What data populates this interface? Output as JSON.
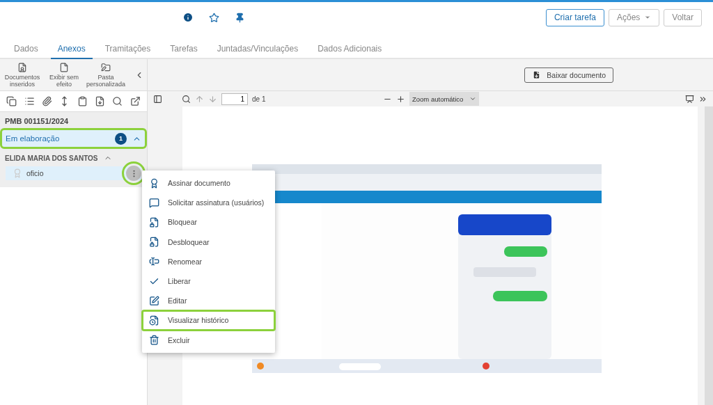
{
  "header": {
    "buttons": [
      {
        "label": "Criar tarefa",
        "kind": "primary"
      },
      {
        "label": "Ações",
        "kind": "dropdown"
      },
      {
        "label": "Voltar",
        "kind": "plain"
      }
    ]
  },
  "tabs": [
    {
      "label": "Dados",
      "selected": false
    },
    {
      "label": "Anexos",
      "selected": true
    },
    {
      "label": "Tramitações",
      "selected": false
    },
    {
      "label": "Tarefas",
      "selected": false
    },
    {
      "label": "Juntadas/Vinculações",
      "selected": false
    },
    {
      "label": "Dados Adicionais",
      "selected": false
    }
  ],
  "left_toolbar": [
    {
      "label": "Documentos inseridos"
    },
    {
      "label": "Exibir sem efeito"
    },
    {
      "label": "Pasta personalizada"
    }
  ],
  "process_number": "PMB 001151/2024",
  "group": {
    "label": "Em elaboração",
    "count": "1",
    "expanded": true,
    "highlighted": true
  },
  "author": {
    "name": "ELIDA MARIA DOS SANTOS",
    "expanded": true
  },
  "documents": [
    {
      "name": "oficio",
      "selected": true,
      "menu_highlighted": true
    }
  ],
  "viewer": {
    "download": "Baixar documento",
    "page": "1",
    "page_total": "de 1",
    "zoom": "Zoom automático"
  },
  "context_menu": [
    {
      "label": "Assinar documento",
      "highlighted": false
    },
    {
      "label": "Solicitar assinatura (usuários)",
      "highlighted": false
    },
    {
      "label": "Bloquear",
      "highlighted": false
    },
    {
      "label": "Desbloquear",
      "highlighted": false
    },
    {
      "label": "Renomear",
      "highlighted": false
    },
    {
      "label": "Liberar",
      "highlighted": false
    },
    {
      "label": "Editar",
      "highlighted": false
    },
    {
      "label": "Visualizar histórico",
      "highlighted": true
    },
    {
      "label": "Excluir",
      "highlighted": false
    }
  ]
}
